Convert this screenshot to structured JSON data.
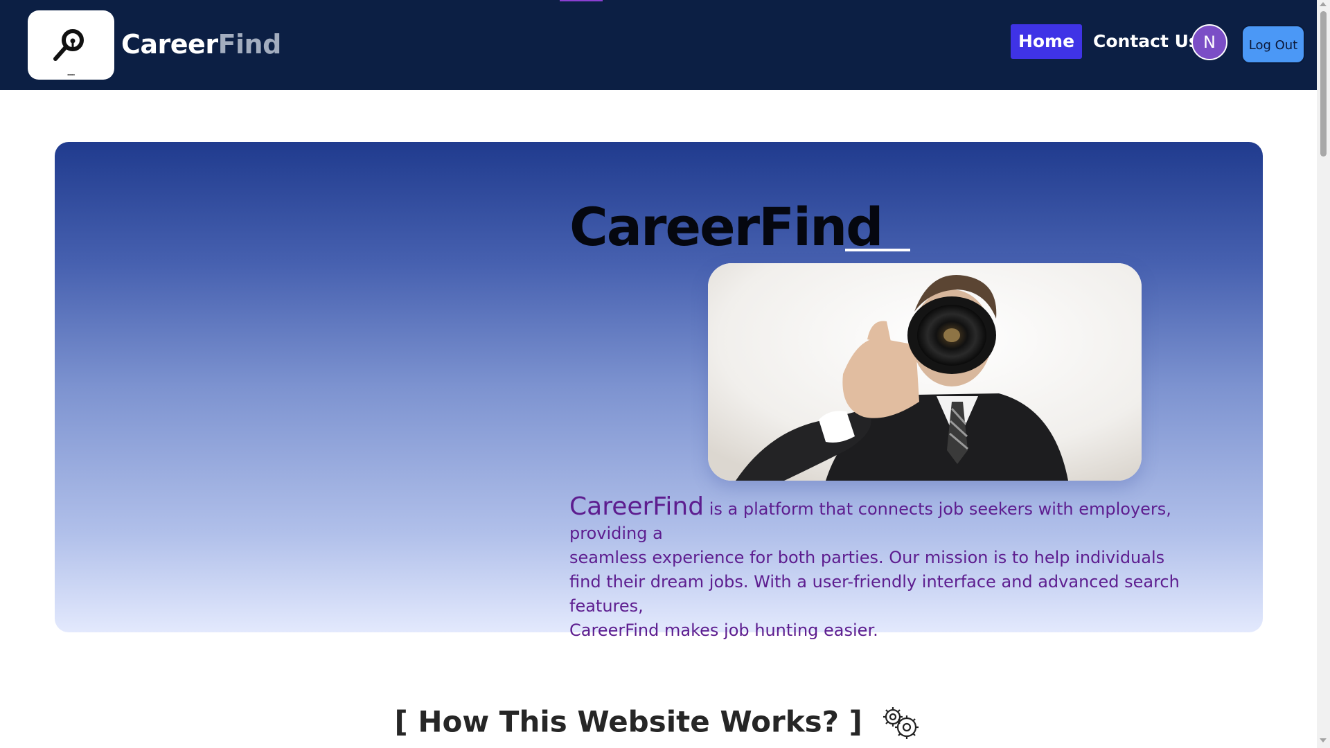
{
  "navbar": {
    "brand_part1": "Career",
    "brand_part2": "Find",
    "logo_icon": "magnifier-key-icon",
    "nav_home": "Home",
    "nav_contact": "Contact Us",
    "avatar_letter": "N",
    "logout_label": "Log Out",
    "colors": {
      "background": "#0c1f44",
      "home_active": "#3f33e6",
      "avatar": "#7b4ec6",
      "logout": "#4b98f6"
    }
  },
  "hero": {
    "title": "CareerFind",
    "photo_alt": "Man in a suit looking through a camera lens",
    "description_lead": "CareerFind",
    "description_line1": " is a platform that connects job seekers with employers, providing a",
    "description_line2": "seamless experience for both parties. Our mission is to help individuals",
    "description_line3": "find their dream jobs. With a user-friendly interface and advanced search features,",
    "description_line4": "CareerFind makes job hunting easier.",
    "colors": {
      "gradient_top": "#203b8e",
      "gradient_bottom": "#e3e9fd",
      "description_text": "#5d1d8f"
    }
  },
  "section": {
    "heading": "[ How This Website Works? ]",
    "heading_icon": "gears-icon"
  }
}
